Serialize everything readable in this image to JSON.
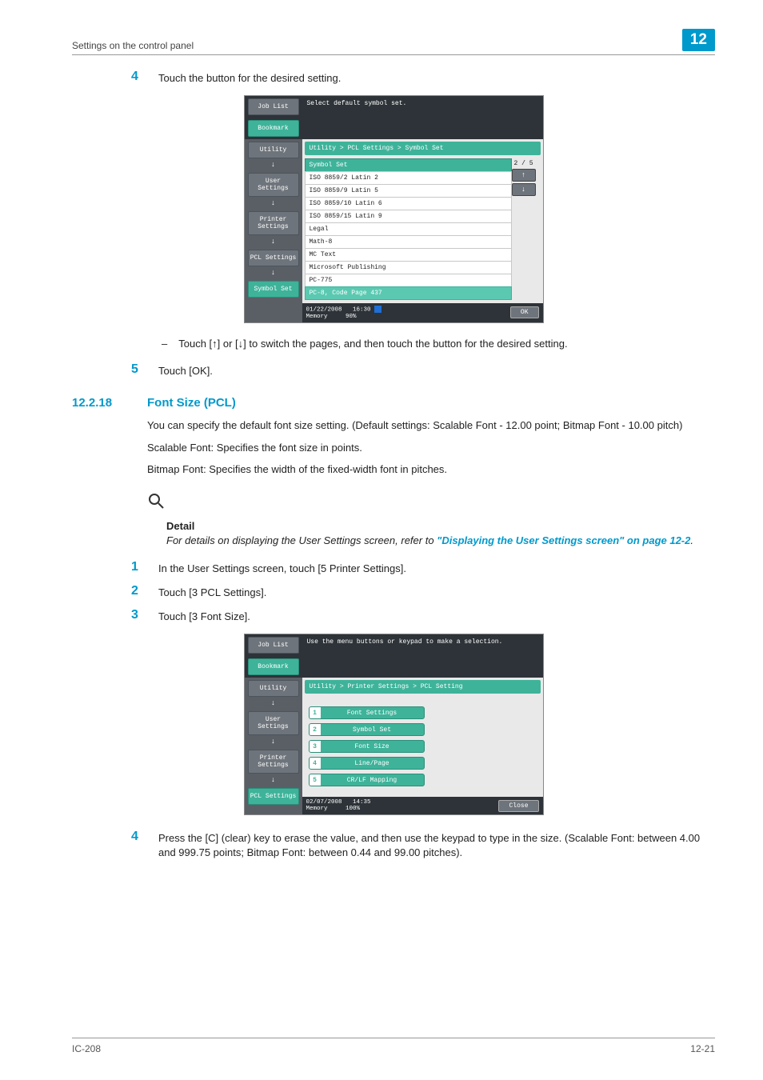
{
  "header": {
    "section": "Settings on the control panel",
    "chapter": "12"
  },
  "footer": {
    "left": "IC-208",
    "right": "12-21"
  },
  "step4": {
    "num": "4",
    "text": "Touch the button for the desired setting."
  },
  "note1": "Touch [↑] or [↓] to switch the pages, and then touch the button for the desired setting.",
  "step5": {
    "num": "5",
    "text": "Touch [OK]."
  },
  "heading": {
    "num": "12.2.18",
    "title": "Font Size (PCL)"
  },
  "para1": "You can specify the default font size setting. (Default settings: Scalable Font - 12.00 point; Bitmap Font - 10.00 pitch)",
  "para2": "Scalable Font: Specifies the font size in points.",
  "para3": "Bitmap Font: Specifies the width of the fixed-width font in pitches.",
  "detail": {
    "label": "Detail",
    "lead": "For details on displaying the User Settings screen, refer to ",
    "link": "\"Displaying the User Settings screen\" on page 12-2",
    "tail": "."
  },
  "b_step1": {
    "num": "1",
    "text": "In the User Settings screen, touch [5 Printer Settings]."
  },
  "b_step2": {
    "num": "2",
    "text": "Touch [3 PCL Settings]."
  },
  "b_step3": {
    "num": "3",
    "text": "Touch [3 Font Size]."
  },
  "b_step4": {
    "num": "4",
    "text": "Press the [C] (clear) key to erase the value, and then use the keypad to type in the size. (Scalable Font: between 4.00 and 999.75 points; Bitmap Font: between 0.44 and 99.00 pitches)."
  },
  "screen1": {
    "jobList": "Job List",
    "bookmark": "Bookmark",
    "msg": "Select default symbol set.",
    "crumb": "Utility > PCL Settings > Symbol Set",
    "nav": [
      "Utility",
      "User Settings",
      "Printer Settings",
      "PCL Settings",
      "Symbol Set"
    ],
    "listHeader": "Symbol Set",
    "pager": "2 / 5",
    "items": [
      "ISO 8859/2 Latin 2",
      "ISO 8859/9 Latin 5",
      "ISO 8859/10 Latin 6",
      "ISO 8859/15 Latin 9",
      "Legal",
      "Math-8",
      "MC Text",
      "Microsoft Publishing",
      "PC-775",
      "PC-8, Code Page 437"
    ],
    "status": {
      "date": "01/22/2008",
      "time": "16:30",
      "memLabel": "Memory",
      "mem": "90%",
      "ok": "OK"
    }
  },
  "screen2": {
    "jobList": "Job List",
    "bookmark": "Bookmark",
    "msg": "Use the menu buttons or keypad to make a selection.",
    "crumb": "Utility > Printer Settings > PCL Setting",
    "nav": [
      "Utility",
      "User Settings",
      "Printer Settings",
      "PCL Settings"
    ],
    "menu": [
      {
        "n": "1",
        "l": "Font Settings"
      },
      {
        "n": "2",
        "l": "Symbol Set"
      },
      {
        "n": "3",
        "l": "Font Size"
      },
      {
        "n": "4",
        "l": "Line/Page"
      },
      {
        "n": "5",
        "l": "CR/LF Mapping"
      }
    ],
    "status": {
      "date": "02/07/2008",
      "time": "14:35",
      "memLabel": "Memory",
      "mem": "100%",
      "close": "Close"
    }
  }
}
